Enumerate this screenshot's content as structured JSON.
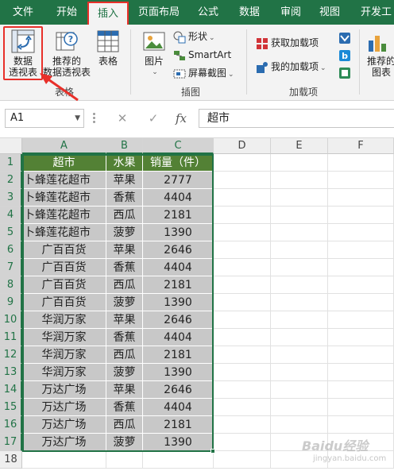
{
  "ribbon_tabs": [
    "文件",
    "开始",
    "插入",
    "页面布局",
    "公式",
    "数据",
    "审阅",
    "视图",
    "开发工"
  ],
  "active_tab": "插入",
  "ribbon": {
    "pivot_table_label_1": "数据",
    "pivot_table_label_2": "透视表",
    "recommended_pivot_label_1": "推荐的",
    "recommended_pivot_label_2": "数据透视表",
    "table_label": "表格",
    "group_tables": "表格",
    "pictures_label": "图片",
    "shapes_label": "形状",
    "smartart_label": "SmartArt",
    "screenshot_label": "屏幕截图",
    "group_illustrations": "插图",
    "get_addins_label": "获取加载项",
    "my_addins_label": "我的加载项",
    "group_addins": "加载项",
    "recommended_charts_label_1": "推荐的",
    "recommended_charts_label_2": "图表"
  },
  "formula_bar": {
    "name_box": "A1",
    "cancel_symbol": "✕",
    "enter_symbol": "✓",
    "fx_symbol": "fx",
    "content": "超市"
  },
  "columns": [
    "A",
    "B",
    "C",
    "D",
    "E",
    "F"
  ],
  "rows": [
    "1",
    "2",
    "3",
    "4",
    "5",
    "6",
    "7",
    "8",
    "9",
    "10",
    "11",
    "12",
    "13",
    "14",
    "15",
    "16",
    "17",
    "18"
  ],
  "table": {
    "headers": [
      "超市",
      "水果",
      "销量（件）"
    ],
    "rows": [
      [
        "卜蜂莲花超市",
        "苹果",
        "2777"
      ],
      [
        "卜蜂莲花超市",
        "香蕉",
        "4404"
      ],
      [
        "卜蜂莲花超市",
        "西瓜",
        "2181"
      ],
      [
        "卜蜂莲花超市",
        "菠萝",
        "1390"
      ],
      [
        "广百百货",
        "苹果",
        "2646"
      ],
      [
        "广百百货",
        "香蕉",
        "4404"
      ],
      [
        "广百百货",
        "西瓜",
        "2181"
      ],
      [
        "广百百货",
        "菠萝",
        "1390"
      ],
      [
        "华润万家",
        "苹果",
        "2646"
      ],
      [
        "华润万家",
        "香蕉",
        "4404"
      ],
      [
        "华润万家",
        "西瓜",
        "2181"
      ],
      [
        "华润万家",
        "菠萝",
        "1390"
      ],
      [
        "万达广场",
        "苹果",
        "2646"
      ],
      [
        "万达广场",
        "香蕉",
        "4404"
      ],
      [
        "万达广场",
        "西瓜",
        "2181"
      ],
      [
        "万达广场",
        "菠萝",
        "1390"
      ]
    ]
  },
  "watermark": "Baidu经验",
  "watermark_url": "jingyan.baidu.com",
  "colors": {
    "excel_green": "#217346",
    "header_fill": "#538135",
    "data_fill": "#c8c8c8",
    "highlight_red": "#e8302a"
  }
}
